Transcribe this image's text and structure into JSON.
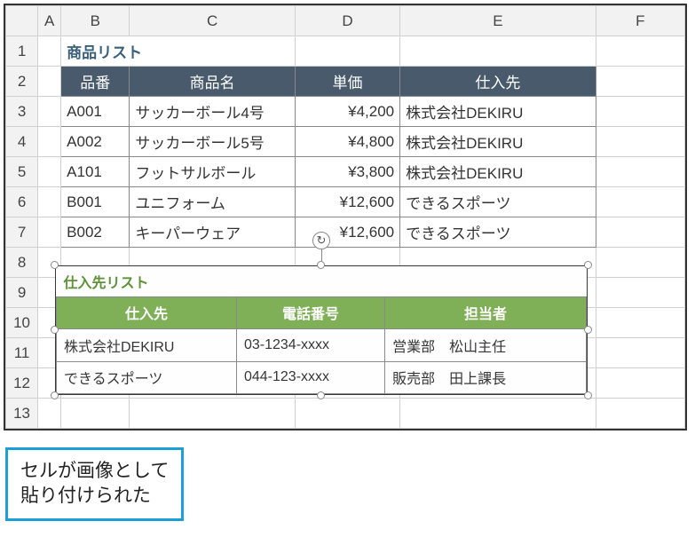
{
  "columns": [
    "A",
    "B",
    "C",
    "D",
    "E",
    "F"
  ],
  "rows": [
    "1",
    "2",
    "3",
    "4",
    "5",
    "6",
    "7",
    "8",
    "9",
    "10",
    "11",
    "12",
    "13"
  ],
  "table1": {
    "title": "商品リスト",
    "headers": [
      "品番",
      "商品名",
      "単価",
      "仕入先"
    ],
    "rows": [
      {
        "code": "A001",
        "name": "サッカーボール4号",
        "price": "¥4,200",
        "supplier": "株式会社DEKIRU"
      },
      {
        "code": "A002",
        "name": "サッカーボール5号",
        "price": "¥4,800",
        "supplier": "株式会社DEKIRU"
      },
      {
        "code": "A101",
        "name": "フットサルボール",
        "price": "¥3,800",
        "supplier": "株式会社DEKIRU"
      },
      {
        "code": "B001",
        "name": "ユニフォーム",
        "price": "¥12,600",
        "supplier": "できるスポーツ"
      },
      {
        "code": "B002",
        "name": "キーパーウェア",
        "price": "¥12,600",
        "supplier": "できるスポーツ"
      }
    ]
  },
  "table2": {
    "title": "仕入先リスト",
    "headers": [
      "仕入先",
      "電話番号",
      "担当者"
    ],
    "rows": [
      {
        "supplier": "株式会社DEKIRU",
        "phone": "03-1234-xxxx",
        "contact": "営業部　松山主任"
      },
      {
        "supplier": "できるスポーツ",
        "phone": "044-123-xxxx",
        "contact": "販売部　田上課長"
      }
    ]
  },
  "rotate_glyph": "↻",
  "callout": {
    "line1": "セルが画像として",
    "line2": "貼り付けられた"
  }
}
